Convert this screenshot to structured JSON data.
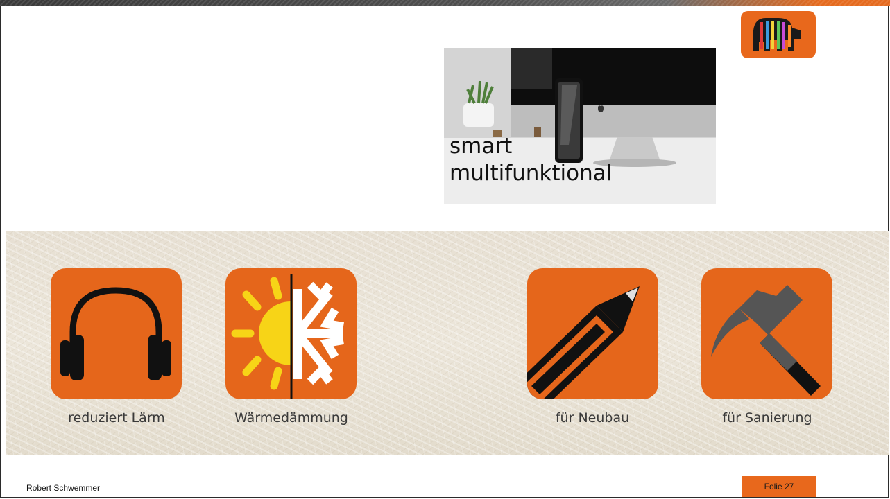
{
  "slide": {
    "author": "Robert Schwemmer",
    "slide_number": "Folie 27"
  },
  "photo": {
    "caption_line1": "smart",
    "caption_line2": "multifunktional"
  },
  "features": [
    {
      "label": "reduziert Lärm",
      "icon": "headphones-icon"
    },
    {
      "label": "Wärmedämmung",
      "icon": "sun-snowflake-icon"
    },
    {
      "label": "für Neubau",
      "icon": "pencil-icon"
    },
    {
      "label": "für Sanierung",
      "icon": "hammer-icon"
    }
  ],
  "colors": {
    "brand_orange": "#e5661b",
    "band_texture": "#e7e0d3"
  }
}
